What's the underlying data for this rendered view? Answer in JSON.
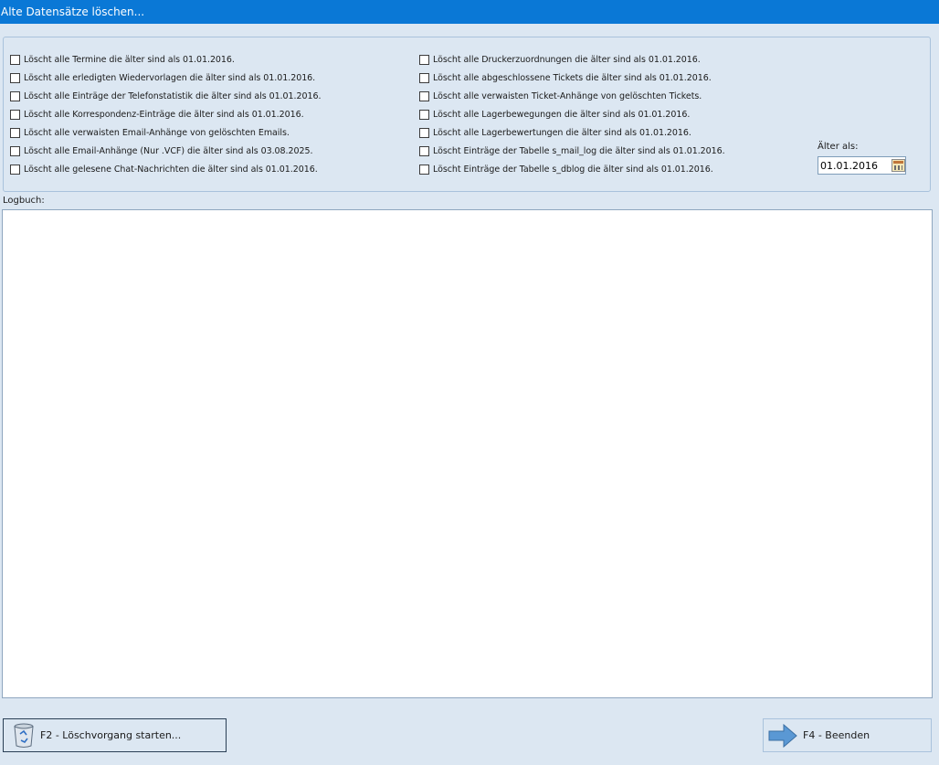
{
  "window": {
    "title": "Alte Datensätze löschen..."
  },
  "options_left": [
    {
      "label": "Löscht alle Termine die älter sind als 01.01.2016.",
      "checked": false
    },
    {
      "label": "Löscht alle erledigten Wiedervorlagen die älter sind als 01.01.2016.",
      "checked": false
    },
    {
      "label": "Löscht alle Einträge der Telefonstatistik die älter sind als 01.01.2016.",
      "checked": false
    },
    {
      "label": "Löscht alle Korrespondenz-Einträge die älter sind als 01.01.2016.",
      "checked": false
    },
    {
      "label": "Löscht alle verwaisten Email-Anhänge von gelöschten Emails.",
      "checked": false
    },
    {
      "label": "Löscht alle Email-Anhänge (Nur .VCF) die älter sind als 03.08.2025.",
      "checked": false
    },
    {
      "label": "Löscht alle gelesene Chat-Nachrichten die älter sind als 01.01.2016.",
      "checked": false
    }
  ],
  "options_right": [
    {
      "label": "Löscht alle Druckerzuordnungen die älter sind als 01.01.2016.",
      "checked": false
    },
    {
      "label": "Löscht alle abgeschlossene Tickets die älter sind als 01.01.2016.",
      "checked": false
    },
    {
      "label": "Löscht alle verwaisten Ticket-Anhänge von gelöschten Tickets.",
      "checked": false
    },
    {
      "label": "Löscht alle Lagerbewegungen die älter sind als 01.01.2016.",
      "checked": false
    },
    {
      "label": "Löscht alle Lagerbewertungen die älter sind als 01.01.2016.",
      "checked": false
    },
    {
      "label": "Löscht Einträge der Tabelle s_mail_log die älter sind als 01.01.2016.",
      "checked": false
    },
    {
      "label": "Löscht Einträge der Tabelle s_dblog die älter sind als 01.01.2016.",
      "checked": false
    }
  ],
  "date_filter": {
    "label": "Älter als:",
    "value": "01.01.2016"
  },
  "log": {
    "label": "Logbuch:",
    "content": ""
  },
  "buttons": {
    "start_label": "F2 - Löschvorgang starten...",
    "end_label": "F4 - Beenden"
  }
}
